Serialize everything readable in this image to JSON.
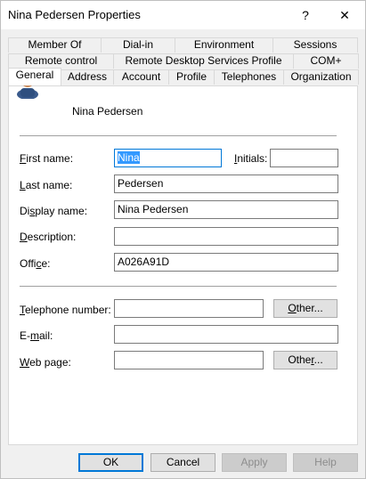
{
  "window": {
    "title": "Nina Pedersen Properties",
    "help_glyph": "?",
    "close_glyph": "✕"
  },
  "tabs": {
    "row1": [
      "Member Of",
      "Dial-in",
      "Environment",
      "Sessions"
    ],
    "row2": [
      "Remote control",
      "Remote Desktop Services Profile",
      "COM+"
    ],
    "row3": [
      "General",
      "Address",
      "Account",
      "Profile",
      "Telephones",
      "Organization"
    ],
    "active": "General"
  },
  "user": {
    "display": "Nina Pedersen",
    "icon": "user-icon"
  },
  "form": {
    "first_name": {
      "label_u": "F",
      "label_rest": "irst name:",
      "value": "Nina"
    },
    "initials": {
      "label_u": "I",
      "label_rest": "nitials:",
      "value": ""
    },
    "last_name": {
      "label_u": "L",
      "label_rest": "ast name:",
      "value": "Pedersen"
    },
    "display_name": {
      "label_pre": "Di",
      "label_u": "s",
      "label_rest": "play name:",
      "value": "Nina Pedersen"
    },
    "description": {
      "label_u": "D",
      "label_rest": "escription:",
      "value": ""
    },
    "office": {
      "label_pre": "Offi",
      "label_u": "c",
      "label_rest": "e:",
      "value": "A026A91D"
    },
    "telephone": {
      "label_u": "T",
      "label_rest": "elephone number:",
      "value": ""
    },
    "email": {
      "label_pre": "E-",
      "label_u": "m",
      "label_rest": "ail:",
      "value": ""
    },
    "webpage": {
      "label_u": "W",
      "label_rest": "eb page:",
      "value": ""
    },
    "other_tel": {
      "label_pre": "",
      "label_u": "O",
      "label_rest": "ther..."
    },
    "other_web": {
      "label_pre": "Othe",
      "label_u": "r",
      "label_rest": "..."
    }
  },
  "buttons": {
    "ok": "OK",
    "cancel": "Cancel",
    "apply": "Apply",
    "help": "Help"
  }
}
